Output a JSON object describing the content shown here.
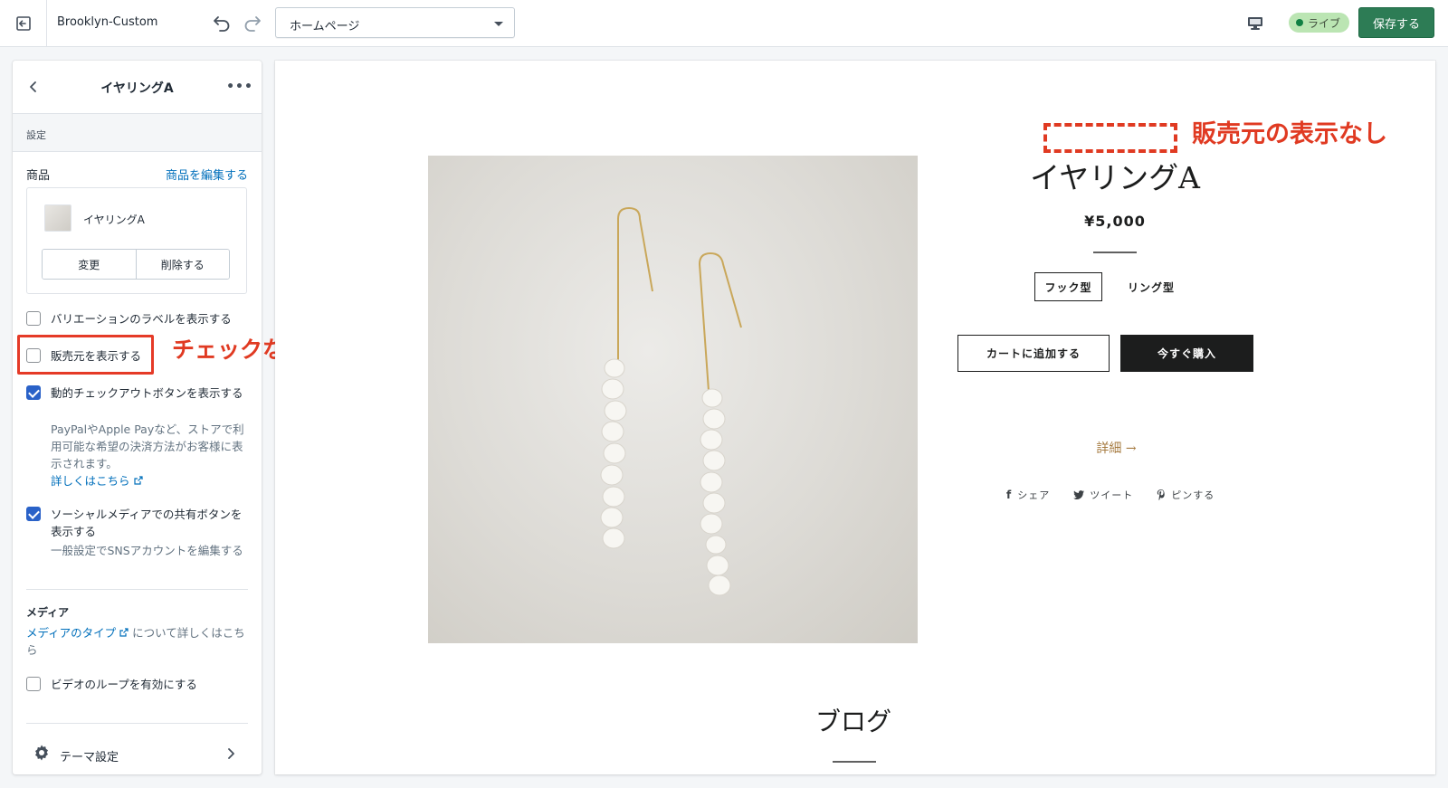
{
  "topbar": {
    "theme_name": "Brooklyn-Custom",
    "page_select_value": "ホームページ",
    "live_label": "ライブ",
    "save_label": "保存する"
  },
  "sidebar": {
    "title": "イヤリングA",
    "more_label": "•••",
    "section_label": "設定",
    "product": {
      "label": "商品",
      "edit_link": "商品を編集する",
      "name": "イヤリングA",
      "change_label": "変更",
      "delete_label": "削除する"
    },
    "options": [
      {
        "label": "バリエーションのラベルを表示する",
        "checked": false
      },
      {
        "label": "販売元を表示する",
        "checked": false
      },
      {
        "label": "動的チェックアウトボタンを表示する",
        "checked": true,
        "help": "PayPalやApple Payなど、ストアで利用可能な希望の決済方法がお客様に表示されます。",
        "help_link": "詳しくはこちら"
      },
      {
        "label": "ソーシャルメディアでの共有ボタンを表示する",
        "checked": true,
        "help": "一般設定でSNSアカウントを編集する"
      }
    ],
    "media": {
      "heading": "メディア",
      "link": "メディアのタイプ",
      "text": "について詳しくはこちら",
      "loop_label": "ビデオのループを有効にする"
    },
    "theme_settings_label": "テーマ設定"
  },
  "annotations": {
    "left": "チェックなし",
    "right": "販売元の表示なし"
  },
  "preview": {
    "product_title": "イヤリングA",
    "price": "¥5,000",
    "variants": [
      "フック型",
      "リング型"
    ],
    "add_to_cart": "カートに追加する",
    "buy_now": "今すぐ購入",
    "details": "詳細 →",
    "share": [
      "シェア",
      "ツイート",
      "ピンする"
    ],
    "blog_title": "ブログ"
  },
  "colors": {
    "accent_blue": "#006fbb",
    "save_green": "#2d7c55",
    "annotation_red": "#e03a22",
    "details_gold": "#a57a3f"
  }
}
